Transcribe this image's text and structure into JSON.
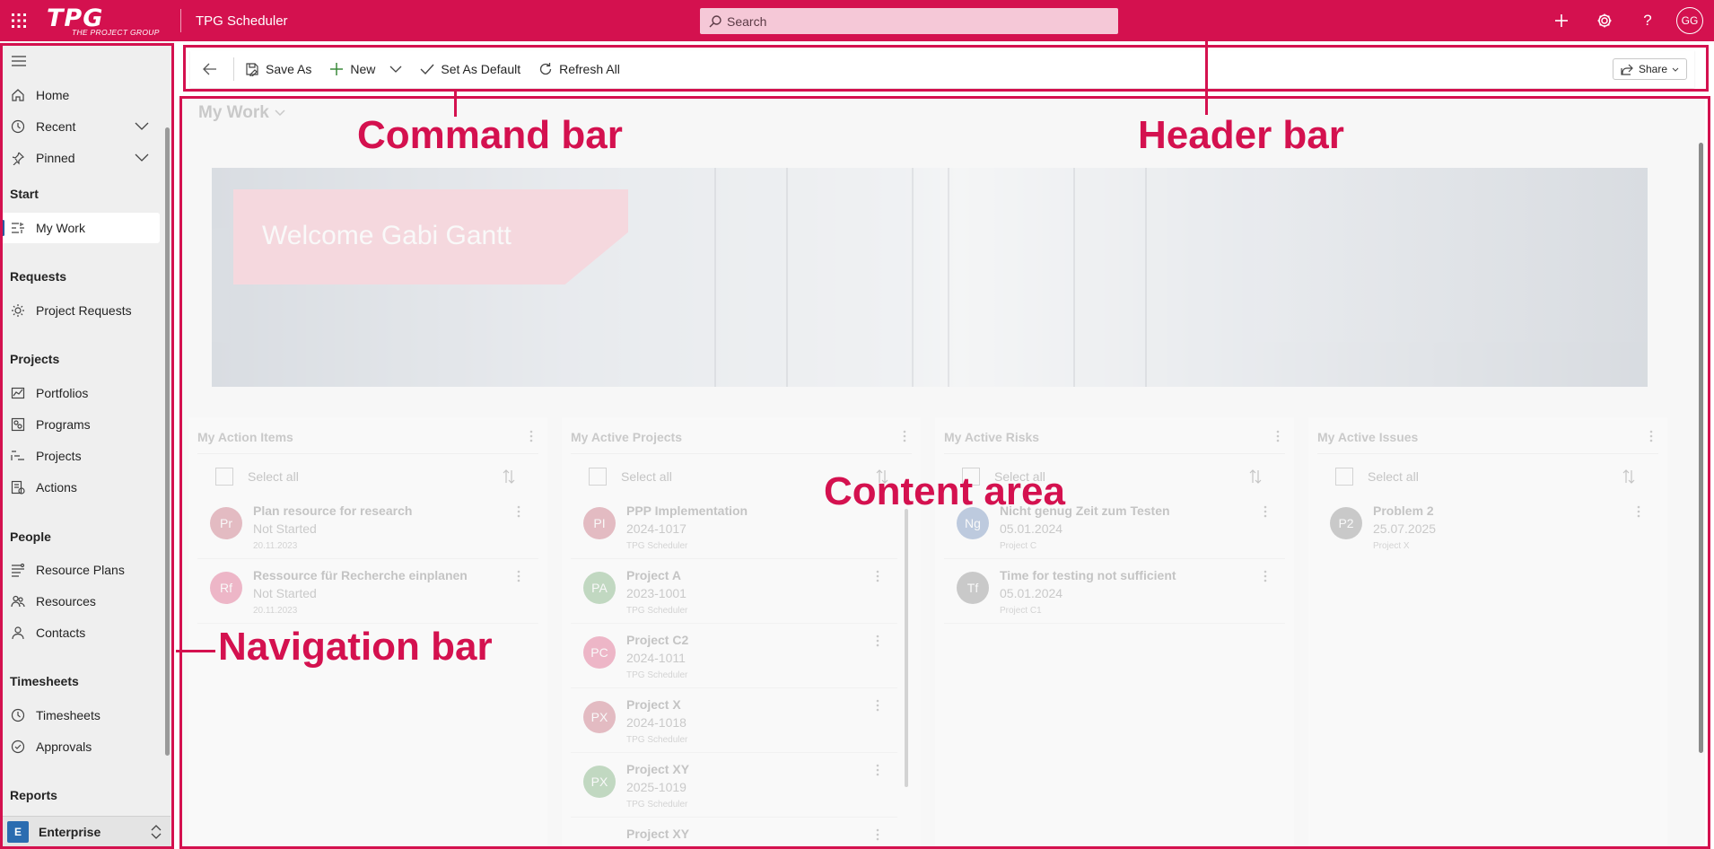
{
  "header": {
    "brand": "TPG",
    "tagline": "THE PROJECT GROUP",
    "app_title": "TPG Scheduler",
    "search_placeholder": "Search",
    "avatar_initials": "GG",
    "color": "#d4114f"
  },
  "sidebar": {
    "items_top": [
      {
        "label": "Home",
        "icon": "home-icon"
      },
      {
        "label": "Recent",
        "icon": "clock-icon"
      },
      {
        "label": "Pinned",
        "icon": "pin-icon"
      }
    ],
    "groups": {
      "start": "Start",
      "requests": "Requests",
      "projects": "Projects",
      "people": "People",
      "timesheets": "Timesheets",
      "reports": "Reports"
    },
    "items": {
      "my_work": "My Work",
      "project_requests": "Project Requests",
      "portfolios": "Portfolios",
      "programs": "Programs",
      "projects": "Projects",
      "actions": "Actions",
      "resource_plans": "Resource Plans",
      "resources": "Resources",
      "contacts": "Contacts",
      "timesheets": "Timesheets",
      "approvals": "Approvals"
    },
    "area_badge": "E",
    "area_label": "Enterprise"
  },
  "commandbar": {
    "save_as": "Save As",
    "new": "New",
    "set_as_default": "Set As Default",
    "refresh_all": "Refresh All",
    "share": "Share"
  },
  "content": {
    "page_title": "My Work",
    "welcome": "Welcome Gabi Gantt",
    "select_all": "Select all",
    "cards": [
      {
        "title": "My Action Items",
        "rows": [
          {
            "initials": "Pr",
            "title": "Plan resource for research",
            "sub": "Not Started",
            "meta": "20.11.2023",
            "color": "#b0243d"
          },
          {
            "initials": "Rf",
            "title": "Ressource für Recherche einplanen",
            "sub": "Not Started",
            "meta": "20.11.2023",
            "color": "#d4114f"
          }
        ]
      },
      {
        "title": "My Active Projects",
        "rows": [
          {
            "initials": "PI",
            "title": "PPP Implementation",
            "sub": "2024-1017",
            "meta": "TPG Scheduler",
            "color": "#b0243d"
          },
          {
            "initials": "PA",
            "title": "Project A",
            "sub": "2023-1001",
            "meta": "TPG Scheduler",
            "color": "#3a8a3a"
          },
          {
            "initials": "PC",
            "title": "Project C2",
            "sub": "2024-1011",
            "meta": "TPG Scheduler",
            "color": "#d4114f"
          },
          {
            "initials": "PX",
            "title": "Project X",
            "sub": "2024-1018",
            "meta": "TPG Scheduler",
            "color": "#b0243d"
          },
          {
            "initials": "PX",
            "title": "Project XY",
            "sub": "2025-1019",
            "meta": "TPG Scheduler",
            "color": "#3a8a3a"
          },
          {
            "initials": "PX",
            "title": "Project XY",
            "sub": "",
            "meta": "",
            "color": "#555555"
          }
        ]
      },
      {
        "title": "My Active Risks",
        "rows": [
          {
            "initials": "Ng",
            "title": "Nicht genug Zeit zum Testen",
            "sub": "05.01.2024",
            "meta": "Project C",
            "color": "#2b5aa0"
          },
          {
            "initials": "Tf",
            "title": "Time for testing not sufficient",
            "sub": "05.01.2024",
            "meta": "Project C1",
            "color": "#555555"
          }
        ]
      },
      {
        "title": "My Active Issues",
        "rows": [
          {
            "initials": "P2",
            "title": "Problem 2",
            "sub": "25.07.2025",
            "meta": "Project X",
            "color": "#555555"
          }
        ]
      }
    ]
  },
  "annotations": {
    "command_bar": "Command bar",
    "header_bar": "Header bar",
    "content_area": "Content area",
    "navigation_bar": "Navigation bar",
    "color": "#d4114f"
  }
}
